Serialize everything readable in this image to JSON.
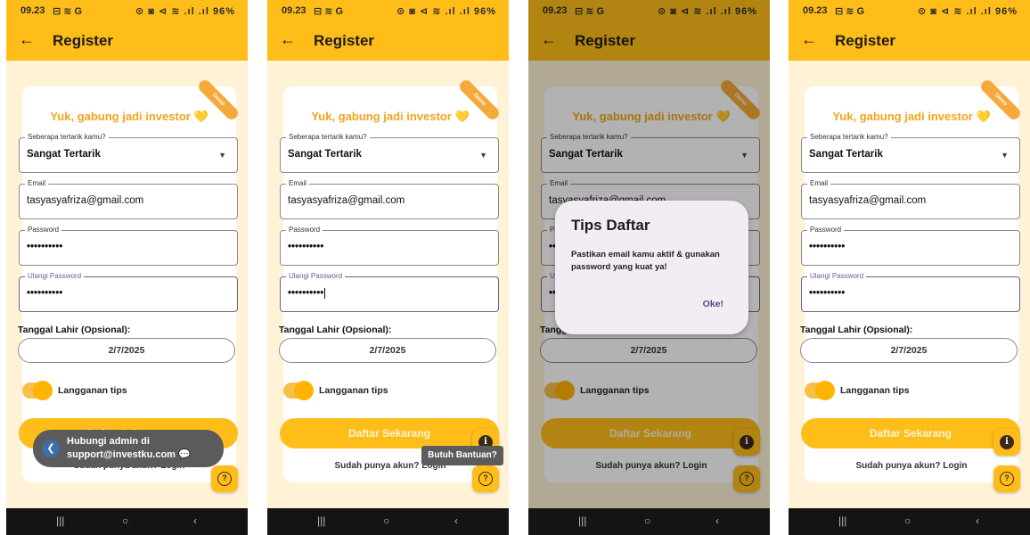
{
  "status_bar": {
    "time": "09.23",
    "left_icons": "⊟ ≋ G",
    "right_icons": "⊙ ◙ ⊲ ≋ .ıl .ıl",
    "battery": "96%"
  },
  "app_bar": {
    "back_icon": "arrow-left-icon",
    "title": "Register"
  },
  "form": {
    "ribbon_text": "Demo",
    "welcome_text": "Yuk, gabung jadi investor",
    "heart_emoji": "💛",
    "interest": {
      "label": "Seberapa tertarik kamu?",
      "value": "Sangat Tertarik"
    },
    "email": {
      "label": "Email",
      "value": "tasyasyafriza@gmail.com"
    },
    "password": {
      "label": "Password",
      "value": "••••••••••"
    },
    "confirm_password": {
      "label": "Ulangi Password",
      "value": "••••••••••"
    },
    "dob": {
      "label": "Tanggal Lahir (Opsional):",
      "value": "2/7/2025"
    },
    "subscribe": {
      "label": "Langganan tips",
      "on": true
    },
    "submit_label": "Daftar Sekarang",
    "login_link": "Sudah punya akun? Login"
  },
  "fabs": {
    "info_glyph": "i",
    "help_glyph": "?"
  },
  "nav": {
    "recents": "|||",
    "home": "○",
    "back": "‹"
  },
  "toast": {
    "icon_glyph": "❮",
    "message_line1": "Hubungi admin di",
    "message_line2": "support@investku.com 💬"
  },
  "tooltip": {
    "text": "Butuh Bantuan?"
  },
  "dialog": {
    "title": "Tips Daftar",
    "message": "Pastikan email kamu aktif & gunakan password yang kuat ya!",
    "ok_label": "Oke!"
  },
  "colors": {
    "accent": "#ffbd1a",
    "background": "#fff2d6",
    "dialog": "#f3ecf4"
  }
}
